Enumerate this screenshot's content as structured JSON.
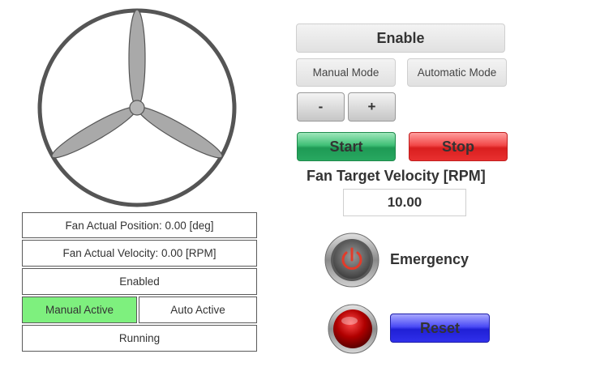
{
  "fan": {
    "position_text": "Fan Actual Position: 0.00 [deg]",
    "velocity_text": "Fan Actual Velocity: 0.00 [RPM]"
  },
  "status": {
    "enabled": "Enabled",
    "manual_active": "Manual Active",
    "auto_active": "Auto Active",
    "running": "Running",
    "active_color": "#7ef07e"
  },
  "controls": {
    "enable_label": "Enable",
    "manual_mode_label": "Manual Mode",
    "automatic_mode_label": "Automatic Mode",
    "minus_label": "-",
    "plus_label": "+",
    "start_label": "Start",
    "stop_label": "Stop",
    "start_color": "#2ea863",
    "stop_color": "#e83030"
  },
  "target": {
    "label": "Fan Target Velocity [RPM]",
    "value": "10.00"
  },
  "emergency": {
    "label": "Emergency",
    "icon": "power-icon"
  },
  "reset": {
    "label": "Reset",
    "color": "#3030ea",
    "indicator_color": "#a00000"
  }
}
